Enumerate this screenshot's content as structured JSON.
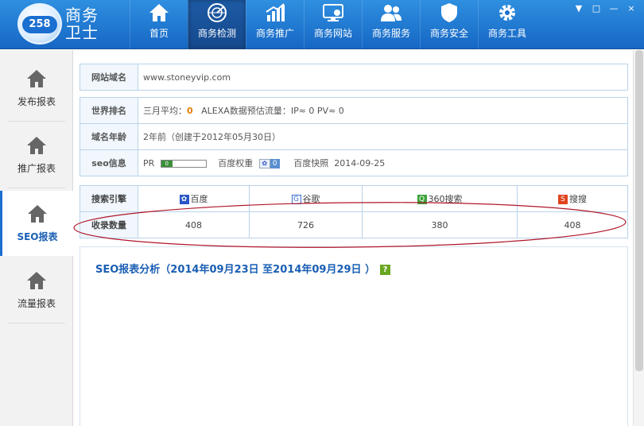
{
  "app": {
    "logo_number": "258",
    "brand_line1": "商务",
    "brand_line2": "卫士"
  },
  "nav": [
    {
      "label": "首页",
      "icon": "home-icon"
    },
    {
      "label": "商务检测",
      "icon": "radar-icon",
      "active": true
    },
    {
      "label": "商务推广",
      "icon": "bar-chart-icon"
    },
    {
      "label": "商务网站",
      "icon": "monitor-icon"
    },
    {
      "label": "商务服务",
      "icon": "users-icon"
    },
    {
      "label": "商务安全",
      "icon": "shield-icon"
    },
    {
      "label": "商务工具",
      "icon": "gear-icon"
    }
  ],
  "window_controls": [
    "▼",
    "□",
    "—",
    "×"
  ],
  "sidebar": [
    {
      "label": "发布报表"
    },
    {
      "label": "推广报表"
    },
    {
      "label": "SEO报表",
      "active": true
    },
    {
      "label": "流量报表"
    }
  ],
  "site": {
    "domain_label": "网站域名",
    "domain": "www.stoneyvip.com",
    "rank_label": "世界排名",
    "rank_prefix": "三月平均：",
    "rank_value": "0",
    "rank_rest": "ALEXA数据预估流量：IP≈ 0 PV≈ 0",
    "age_label": "域名年龄",
    "age_value": "2年前（创建于2012年05月30日）",
    "seo_label": "seo信息",
    "pr_label": "PR",
    "pr_value": "0",
    "baidu_weight_label": "百度权重",
    "baidu_weight_value": "0",
    "snapshot_label": "百度快照",
    "snapshot_date": "2014-09-25"
  },
  "engines": {
    "header_label": "搜索引擎",
    "count_label": "收录数量",
    "columns": [
      {
        "name": "百度",
        "icon": "baidu-icon",
        "count": "408"
      },
      {
        "name": "谷歌",
        "icon": "google-icon",
        "count": "726"
      },
      {
        "name": "360搜索",
        "icon": "search-360-icon",
        "count": "380"
      },
      {
        "name": "搜搜",
        "icon": "sogou-icon",
        "count": "408"
      }
    ]
  },
  "analysis": {
    "title": "SEO报表分析（2014年09月23日 至2014年09月29日 ）",
    "help": "?"
  },
  "colors": {
    "accent": "#1a6fd0",
    "highlight_ellipse": "#b0152a",
    "rank_value": "#e67e00"
  }
}
